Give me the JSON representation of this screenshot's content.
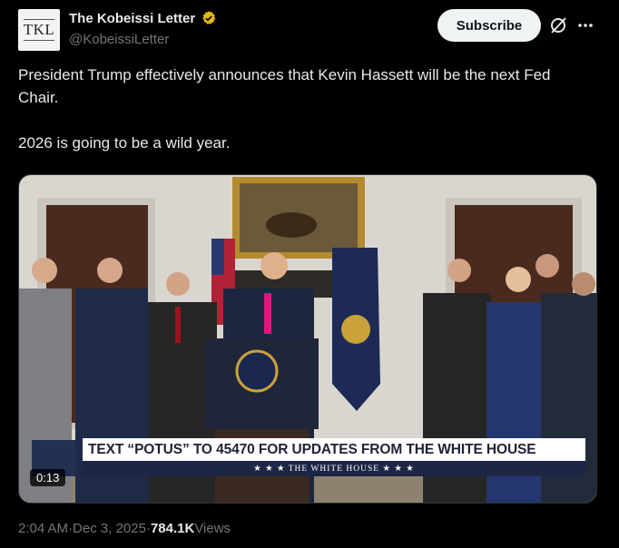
{
  "author": {
    "avatar_text": "TKL",
    "display_name": "The Kobeissi Letter",
    "handle": "@KobeissiLetter"
  },
  "actions": {
    "subscribe_label": "Subscribe",
    "grok_icon": "grok-slash-icon",
    "more_icon": "more-dots-icon"
  },
  "tweet": {
    "paragraph_1": "President Trump effectively announces that Kevin Hassett will be the next Fed Chair.",
    "paragraph_2": "2026 is going to be a wild year."
  },
  "video": {
    "chyron_text": "TEXT “POTUS” TO 45470 FOR UPDATES FROM THE WHITE HOUSE",
    "chyron_subtext": "★ ★ ★   THE WHITE HOUSE   ★ ★ ★",
    "duration": "0:13"
  },
  "meta": {
    "time": "2:04 AM",
    "sep_1": " · ",
    "date": "Dec 3, 2025",
    "sep_2": " · ",
    "views_count": "784.1K",
    "views_label": " Views"
  },
  "colors": {
    "background": "#000000",
    "text_primary": "#e7e9ea",
    "text_secondary": "#71767b",
    "verified_gold": "#e2b719",
    "chyron_navy": "#1d2645"
  }
}
